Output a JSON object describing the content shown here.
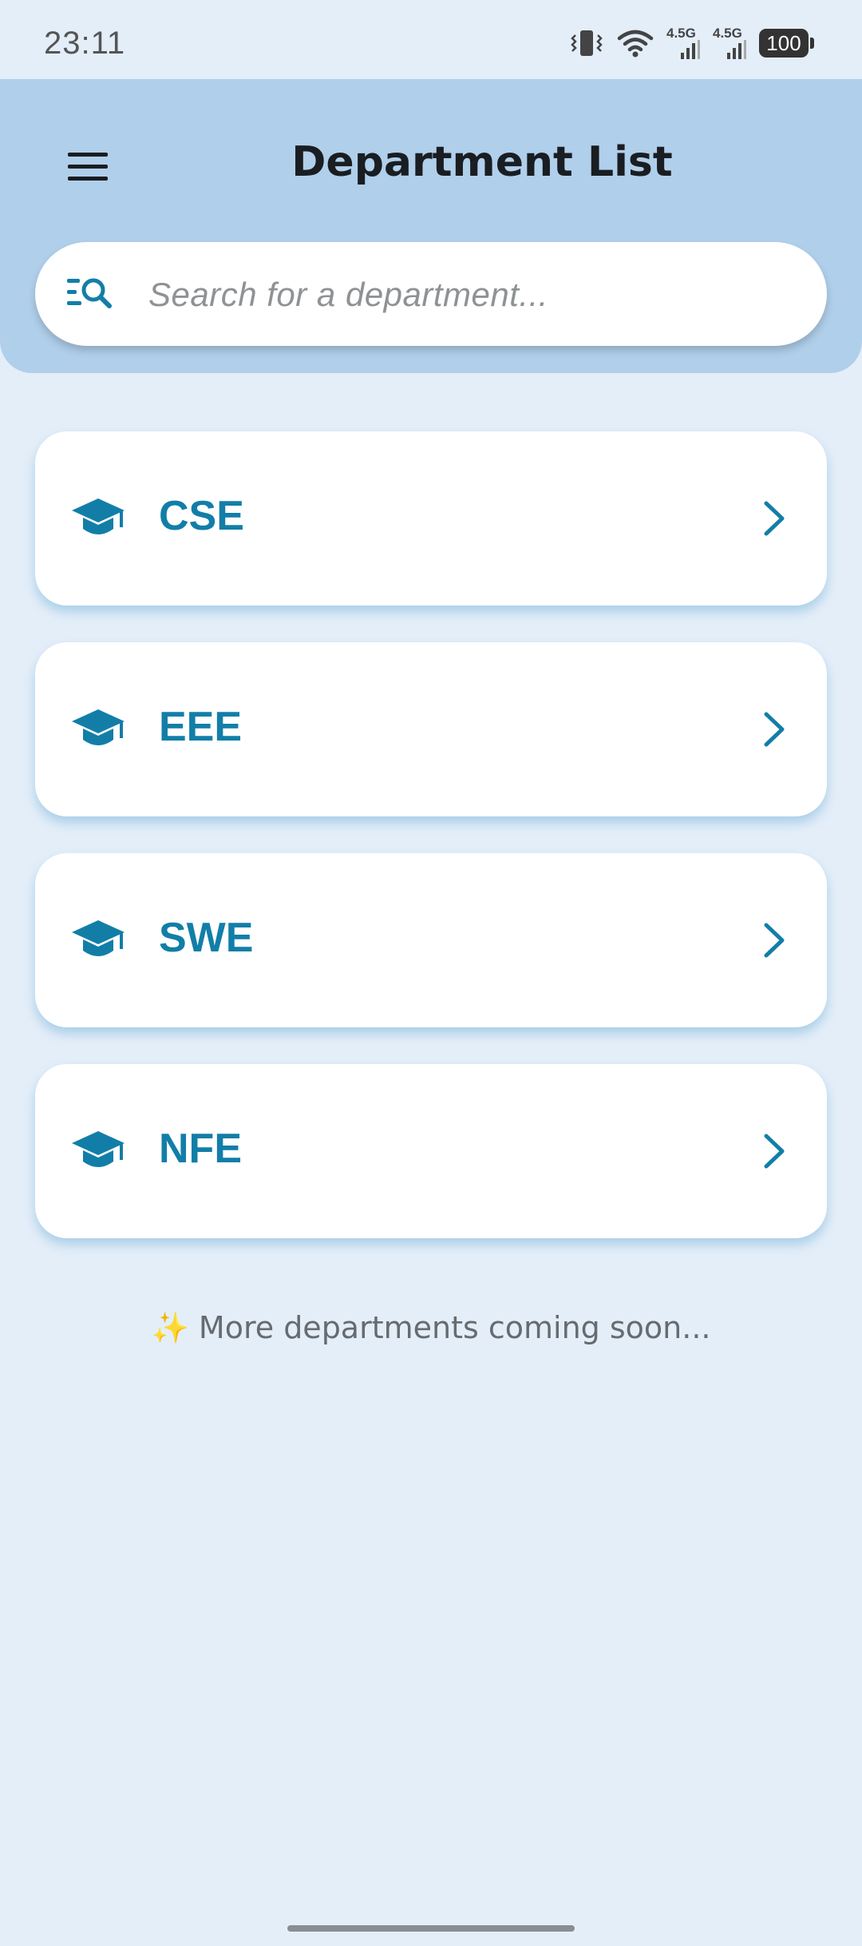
{
  "status_bar": {
    "time": "23:11",
    "network_1": "4.5G",
    "network_2": "4.5G",
    "battery": "100",
    "icons": [
      "vibrate-icon",
      "wifi-icon",
      "signal-icon",
      "signal-icon",
      "battery-icon"
    ]
  },
  "header": {
    "title": "Department List",
    "menu_icon": "hamburger-menu-icon"
  },
  "search": {
    "placeholder": "Search for a department...",
    "value": "",
    "icon": "search-list-icon"
  },
  "departments": [
    {
      "label": "CSE",
      "icon": "graduation-cap-icon"
    },
    {
      "label": "EEE",
      "icon": "graduation-cap-icon"
    },
    {
      "label": "SWE",
      "icon": "graduation-cap-icon"
    },
    {
      "label": "NFE",
      "icon": "graduation-cap-icon"
    }
  ],
  "footer": {
    "sparkle": "✨",
    "note": "More departments coming soon..."
  },
  "colors": {
    "background": "#e4eef9",
    "header": "#b0cfeb",
    "accent": "#127ea8",
    "title": "#1a1d21",
    "card": "#ffffff"
  }
}
